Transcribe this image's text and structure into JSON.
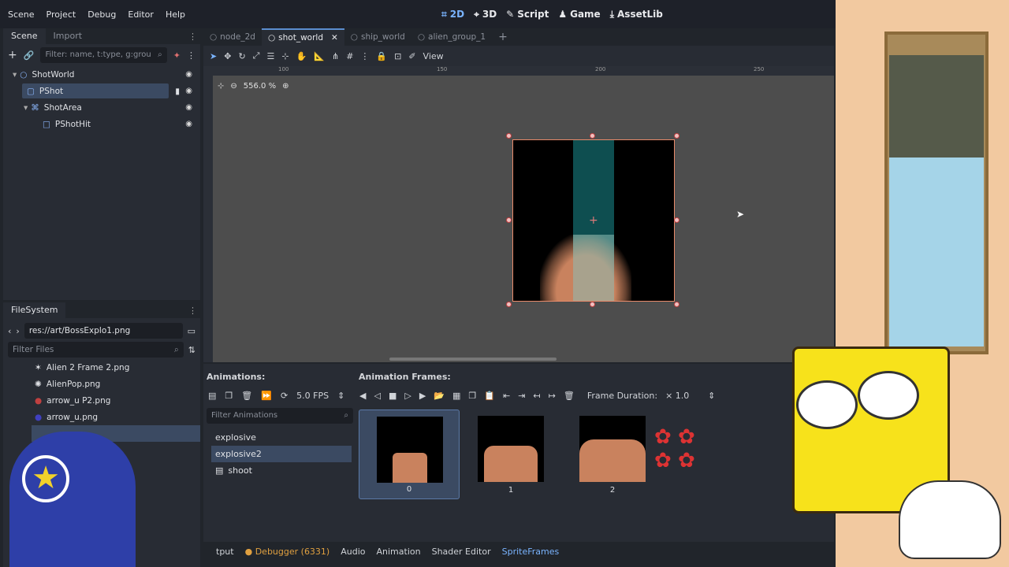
{
  "menubar": {
    "items": [
      "Scene",
      "Project",
      "Debug",
      "Editor",
      "Help"
    ],
    "workspaces": [
      {
        "label": "2D",
        "icon": "2d-icon",
        "active": true
      },
      {
        "label": "3D",
        "icon": "3d-icon",
        "active": false
      },
      {
        "label": "Script",
        "icon": "script-icon",
        "active": false
      },
      {
        "label": "Game",
        "icon": "game-icon",
        "active": false
      },
      {
        "label": "AssetLib",
        "icon": "assetlib-icon",
        "active": false
      }
    ]
  },
  "scene_dock": {
    "tabs": [
      "Scene",
      "Import"
    ],
    "filter_placeholder": "Filter: name, t:type, g:grou",
    "nodes": [
      {
        "label": "ShotWorld"
      },
      {
        "label": "PShot"
      },
      {
        "label": "ShotArea"
      },
      {
        "label": "PShotHit"
      }
    ]
  },
  "filesystem": {
    "title": "FileSystem",
    "path": "res://art/BossExplo1.png",
    "filter_placeholder": "Filter Files",
    "items": [
      "Alien 2 Frame 2.png",
      "AlienPop.png",
      "arrow_u P2.png",
      "arrow_u.png"
    ]
  },
  "scene_tabs": [
    "node_2d",
    "shot_world",
    "ship_world",
    "alien_group_1"
  ],
  "viewport": {
    "toolbar_view_label": "View",
    "zoom": "556.0 %",
    "ruler_labels": [
      "100",
      "150",
      "200",
      "250"
    ]
  },
  "sprite_frames": {
    "animations_label": "Animations:",
    "frames_label": "Animation Frames:",
    "fps": "5.0 FPS",
    "filter_placeholder": "Filter Animations",
    "frame_duration_label": "Frame Duration:",
    "frame_duration_value": "× 1.0",
    "animations": [
      "explosive",
      "explosive2",
      "shoot"
    ],
    "frames": [
      "0",
      "1",
      "2"
    ]
  },
  "bottom_tabs": [
    "tput",
    "Debugger (6331)",
    "Audio",
    "Animation",
    "Shader Editor",
    "SpriteFrames"
  ],
  "colors": {
    "accent": "#7ab4ff",
    "selection": "#3b4a62",
    "sprite_teal": "#0e4e50",
    "sprite_skin": "#c9825e"
  }
}
